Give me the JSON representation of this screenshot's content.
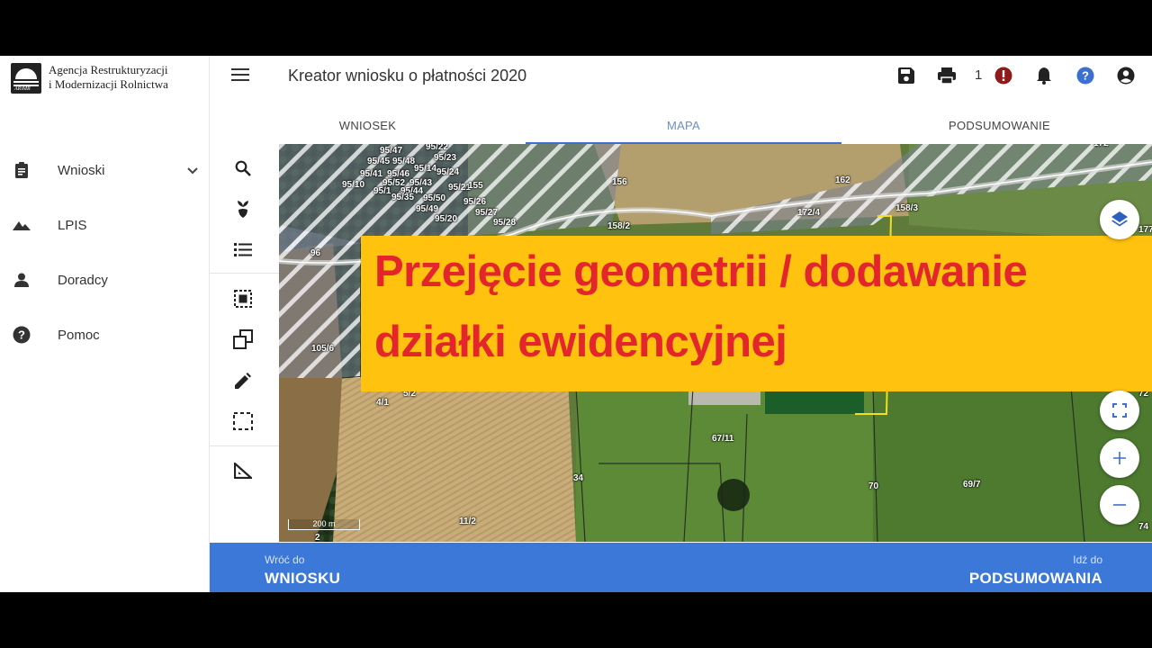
{
  "agency": {
    "line1": "Agencja Restrukturyzacji",
    "line2": "i Modernizacji Rolnictwa",
    "mark_text": "ARiMR"
  },
  "sidebar": {
    "items": [
      {
        "label": "Wnioski",
        "icon": "clipboard-icon"
      },
      {
        "label": "LPIS",
        "icon": "mountains-icon"
      },
      {
        "label": "Doradcy",
        "icon": "person-icon"
      },
      {
        "label": "Pomoc",
        "icon": "help-icon"
      }
    ]
  },
  "header": {
    "title": "Kreator wniosku o płatności 2020",
    "notification_count": "1"
  },
  "tabs": [
    {
      "label": "WNIOSEK"
    },
    {
      "label": "MAPA"
    },
    {
      "label": "PODSUMOWANIE"
    }
  ],
  "active_tab": "MAPA",
  "tools": [
    "search-icon",
    "plant-icon",
    "list-icon",
    "select-area-icon",
    "copy-shape-icon",
    "pencil-icon",
    "dashed-rectangle-icon",
    "measure-icon"
  ],
  "banner": {
    "line1": "Przejęcie geometrii / dodawanie",
    "line2": "działki ewidencyjnej"
  },
  "map": {
    "scale_label": "200 m",
    "parcels": [
      "95/47",
      "95/22",
      "95/45",
      "95/48",
      "95/23",
      "95/41",
      "95/46",
      "95/14",
      "95/24",
      "95/10",
      "95/52",
      "95/43",
      "95/1",
      "95/44",
      "95/21",
      "95/35",
      "95/50",
      "95/26",
      "95/49",
      "95/27",
      "95/20",
      "95/28",
      "155",
      "156",
      "158/2",
      "162",
      "172/4",
      "158/3",
      "96",
      "105/6",
      "4/1",
      "5/2",
      "67/11",
      "34",
      "70",
      "69/7",
      "11/2",
      "2",
      "172",
      "177",
      "72",
      "74"
    ]
  },
  "footer": {
    "back_small": "Wróć do",
    "back_big": "WNIOSKU",
    "next_small": "Idź do",
    "next_big": "PODSUMOWANIA"
  }
}
